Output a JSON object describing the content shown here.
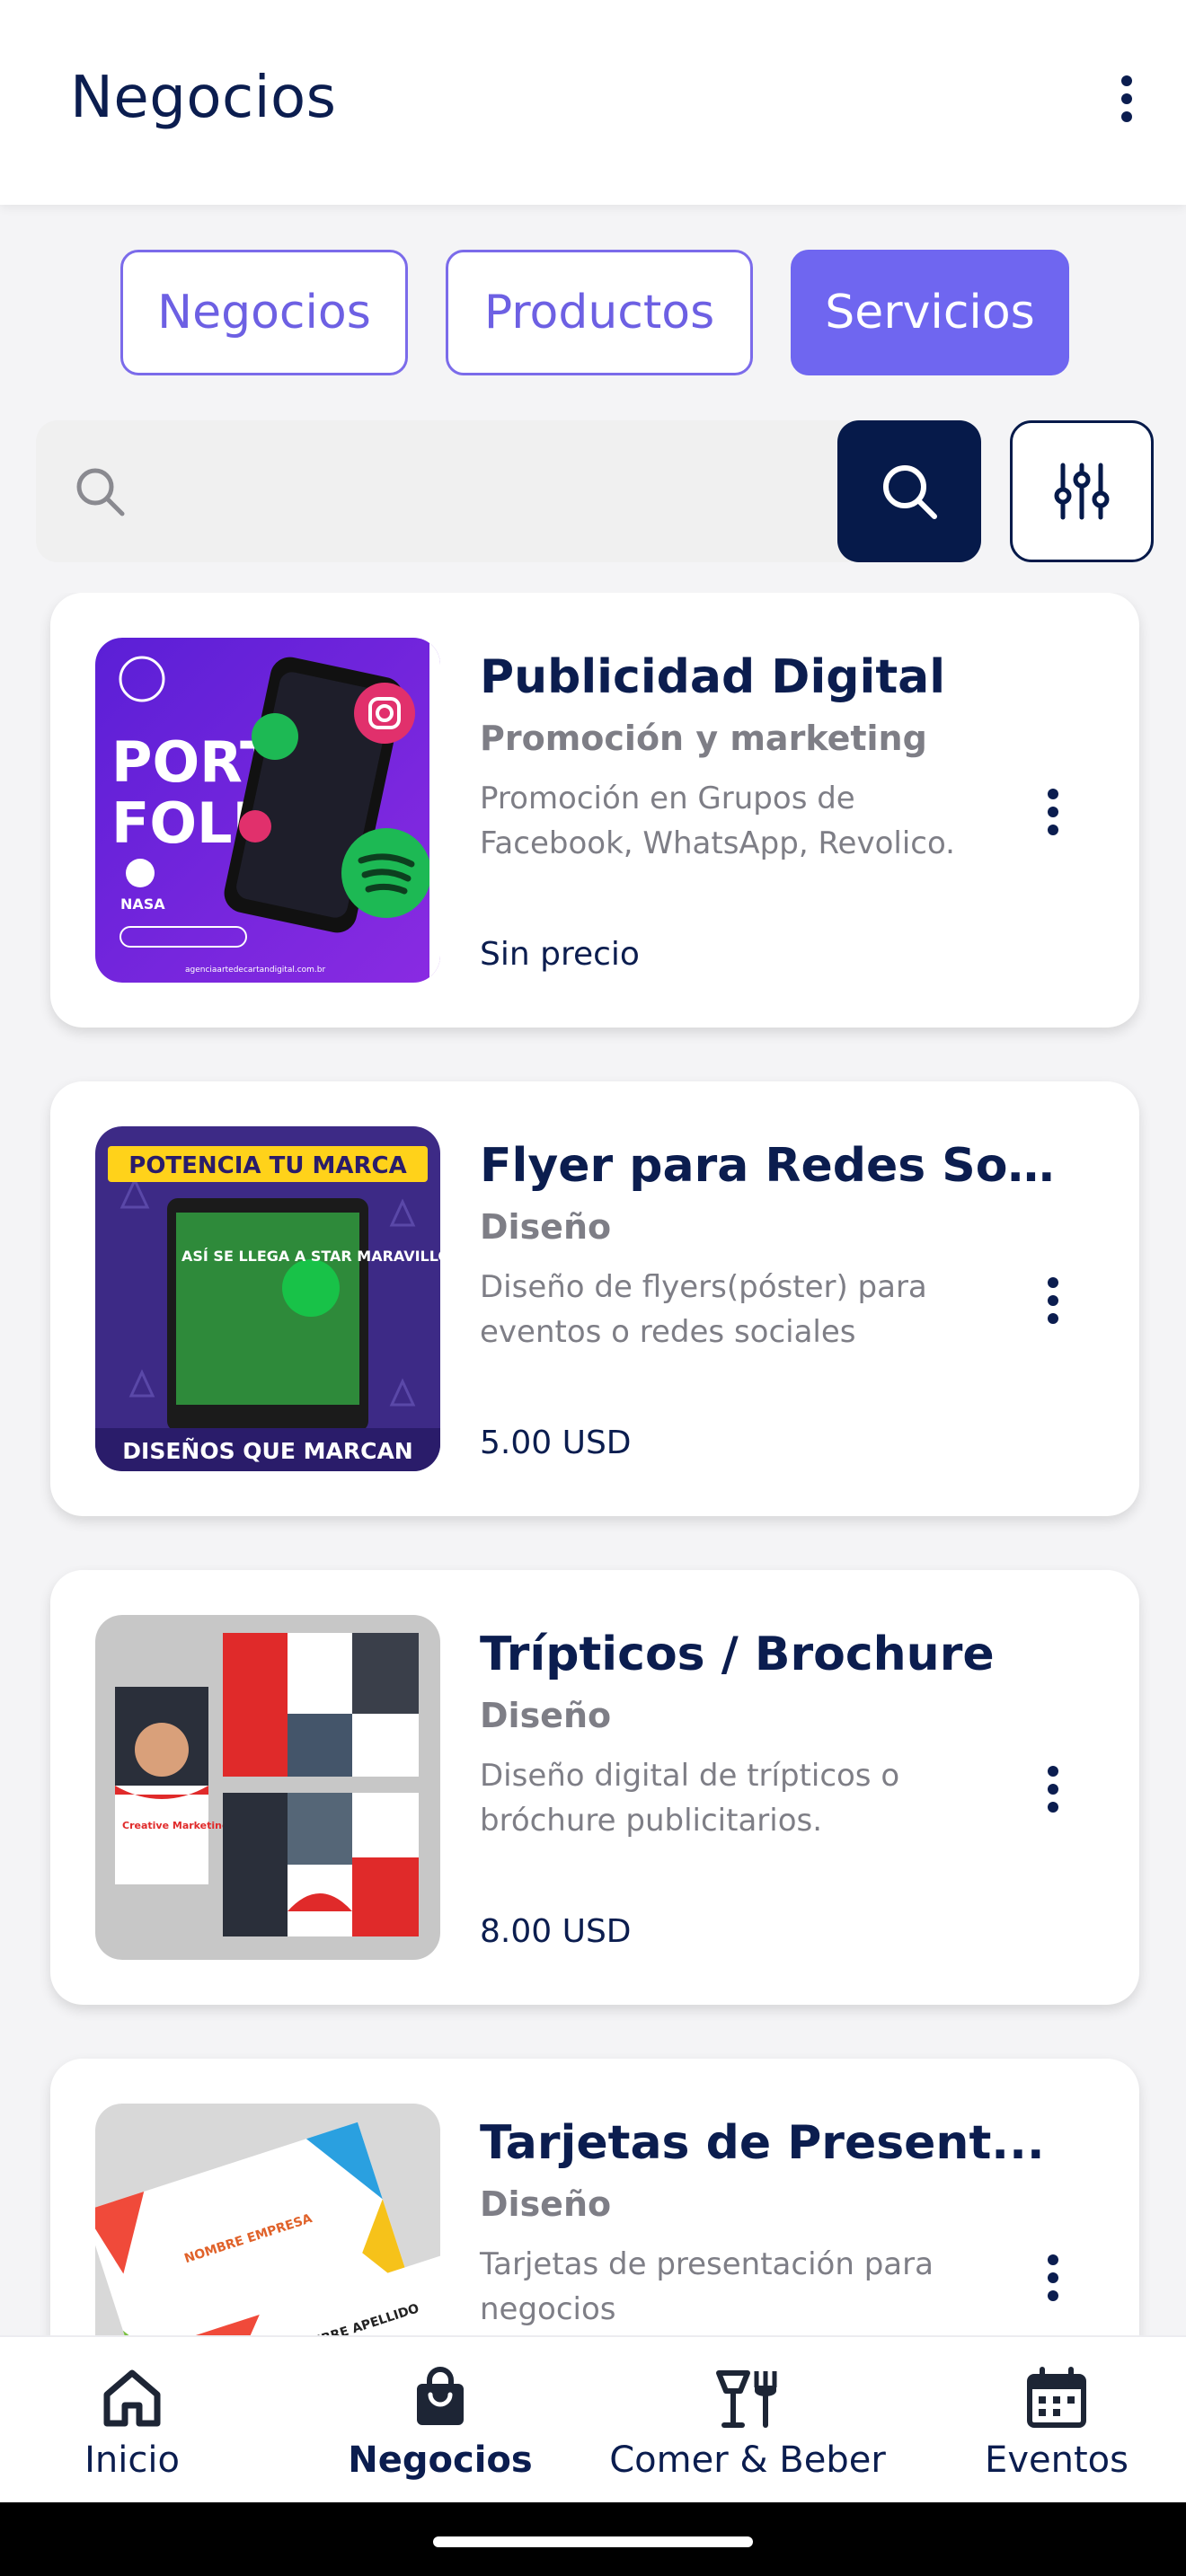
{
  "appbar": {
    "title": "Negocios"
  },
  "segments": [
    {
      "label": "Negocios",
      "active": false
    },
    {
      "label": "Productos",
      "active": false
    },
    {
      "label": "Servicios",
      "active": true
    }
  ],
  "search": {
    "placeholder": ""
  },
  "items": [
    {
      "title": "Publicidad Digital",
      "category": "Promoción y marketing",
      "description": "Promoción en Grupos de Facebook, WhatsApp, Revolico.",
      "price": "Sin precio",
      "thumb_text": [
        "PORT",
        "FOLIO",
        "NASA",
        "agenciaartedecartandigital.com.br"
      ]
    },
    {
      "title": "Flyer para Redes So...",
      "category": "Diseño",
      "description": "Diseño de flyers(póster) para eventos o redes sociales",
      "price": "5.00 USD",
      "thumb_text": [
        "POTENCIA TU MARCA",
        "ASÍ SE LLEGA A STAR MARAVILLOSO",
        "DISEÑOS QUE MARCAN"
      ]
    },
    {
      "title": "Trípticos / Brochure",
      "category": "Diseño",
      "description": "Diseño digital de trípticos o bróchure publicitarios.",
      "price": "8.00 USD",
      "thumb_text": [
        "Creative Marketing Agency"
      ]
    },
    {
      "title": "Tarjetas de Present...",
      "category": "Diseño",
      "description": "Tarjetas de presentación para negocios",
      "price": "",
      "thumb_text": [
        "NOMBRE EMPRESA",
        "NOMBRE APELLIDO"
      ]
    }
  ],
  "nav": [
    {
      "label": "Inicio",
      "icon": "home-icon",
      "active": false
    },
    {
      "label": "Negocios",
      "icon": "shopping-bag-icon",
      "active": true
    },
    {
      "label": "Comer & Beber",
      "icon": "restaurant-icon",
      "active": false
    },
    {
      "label": "Eventos",
      "icon": "calendar-icon",
      "active": false
    }
  ],
  "colors": {
    "primary": "#0b1d4f",
    "accent": "#6f66f0",
    "muted": "#7e7e86"
  }
}
